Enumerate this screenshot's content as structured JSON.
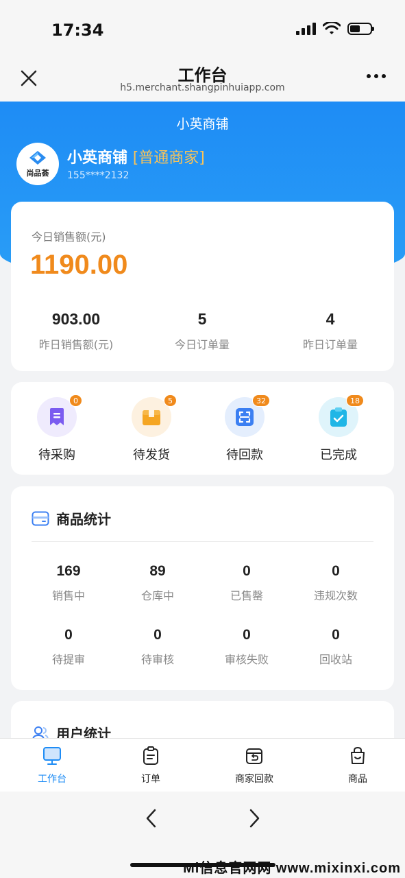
{
  "status_bar": {
    "time": "17:34"
  },
  "nav": {
    "title": "工作台",
    "url": "h5.merchant.shangpinhuiapp.com"
  },
  "shop": {
    "header": "小英商铺",
    "name": "小英商铺",
    "level": "[普通商家]",
    "phone": "155****2132",
    "logo_text": "尚品荟"
  },
  "sales": {
    "today_label": "今日销售额(元)",
    "today_value": "1190.00",
    "stats": [
      {
        "value": "903.00",
        "label": "昨日销售额(元)"
      },
      {
        "value": "5",
        "label": "今日订单量"
      },
      {
        "value": "4",
        "label": "昨日订单量"
      }
    ]
  },
  "orders": [
    {
      "label": "待采购",
      "badge": "0",
      "icon": "receipt-icon",
      "color": "#7b5cf0",
      "bg": "#efebfd"
    },
    {
      "label": "待发货",
      "badge": "5",
      "icon": "package-icon",
      "color": "#f5a623",
      "bg": "#fdf1e0"
    },
    {
      "label": "待回款",
      "badge": "32",
      "icon": "scan-icon",
      "color": "#3b7ff2",
      "bg": "#e4eefd"
    },
    {
      "label": "已完成",
      "badge": "18",
      "icon": "clipboard-check-icon",
      "color": "#1fb6e6",
      "bg": "#dff4fb"
    }
  ],
  "product_stats": {
    "title": "商品统计",
    "items": [
      {
        "value": "169",
        "label": "销售中"
      },
      {
        "value": "89",
        "label": "仓库中"
      },
      {
        "value": "0",
        "label": "已售罄"
      },
      {
        "value": "0",
        "label": "违规次数"
      },
      {
        "value": "0",
        "label": "待提审"
      },
      {
        "value": "0",
        "label": "待审核"
      },
      {
        "value": "0",
        "label": "审核失败"
      },
      {
        "value": "0",
        "label": "回收站"
      }
    ]
  },
  "user_stats": {
    "title": "用户统计"
  },
  "tabs": [
    {
      "label": "工作台",
      "icon": "monitor-icon",
      "active": true
    },
    {
      "label": "订单",
      "icon": "clipboard-icon",
      "active": false
    },
    {
      "label": "商家回款",
      "icon": "refund-box-icon",
      "active": false
    },
    {
      "label": "商品",
      "icon": "shopping-bag-icon",
      "active": false
    }
  ],
  "watermark": "Mi信息官网网 www.mixinxi.com",
  "colors": {
    "brand_blue": "#1e8cf5",
    "accent_orange": "#f08a1c"
  }
}
